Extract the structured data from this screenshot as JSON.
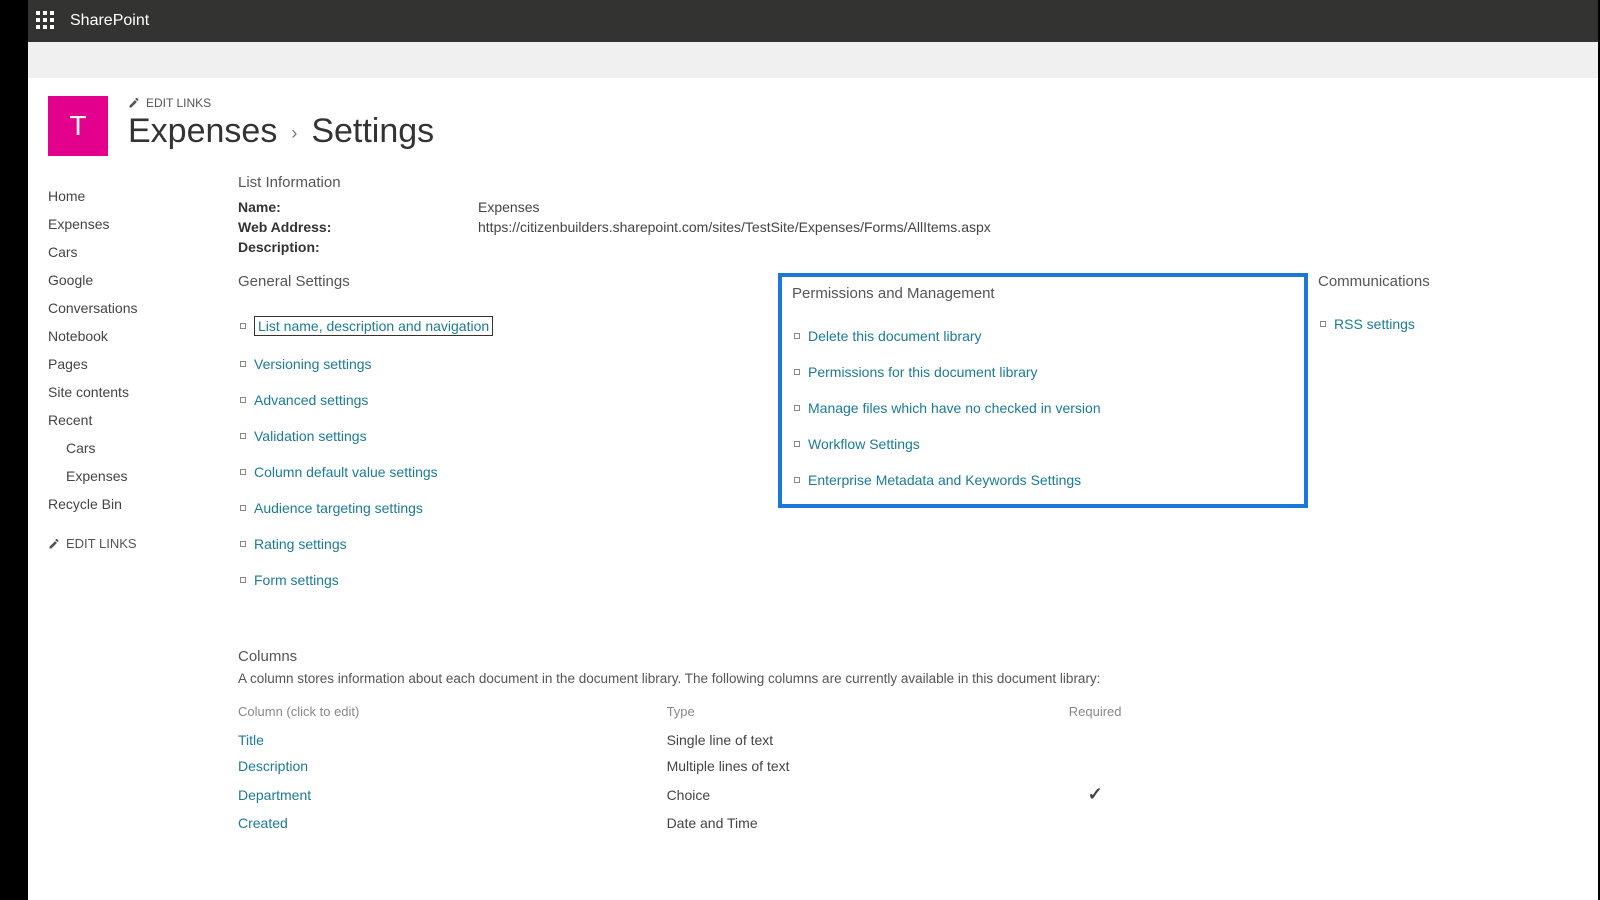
{
  "suite": {
    "product": "SharePoint"
  },
  "site": {
    "logo_letter": "T"
  },
  "editLinksLabel": "EDIT LINKS",
  "breadcrumb": {
    "parent": "Expenses",
    "current": "Settings"
  },
  "leftNav": {
    "items": [
      {
        "label": "Home"
      },
      {
        "label": "Expenses"
      },
      {
        "label": "Cars"
      },
      {
        "label": "Google"
      },
      {
        "label": "Conversations"
      },
      {
        "label": "Notebook"
      },
      {
        "label": "Pages"
      },
      {
        "label": "Site contents"
      }
    ],
    "recentLabel": "Recent",
    "recent": [
      {
        "label": "Cars"
      },
      {
        "label": "Expenses"
      }
    ],
    "recycle": "Recycle Bin"
  },
  "listInfo": {
    "heading": "List Information",
    "nameLabel": "Name:",
    "nameValue": "Expenses",
    "addrLabel": "Web Address:",
    "addrValue": "https://citizenbuilders.sharepoint.com/sites/TestSite/Expenses/Forms/AllItems.aspx",
    "descLabel": "Description:",
    "descValue": ""
  },
  "settings": {
    "general": {
      "heading": "General Settings",
      "links": [
        "List name, description and navigation",
        "Versioning settings",
        "Advanced settings",
        "Validation settings",
        "Column default value settings",
        "Audience targeting settings",
        "Rating settings",
        "Form settings"
      ]
    },
    "perms": {
      "heading": "Permissions and Management",
      "links": [
        "Delete this document library",
        "Permissions for this document library",
        "Manage files which have no checked in version",
        "Workflow Settings",
        "Enterprise Metadata and Keywords Settings"
      ]
    },
    "comm": {
      "heading": "Communications",
      "links": [
        "RSS settings"
      ]
    }
  },
  "columns": {
    "heading": "Columns",
    "desc": "A column stores information about each document in the document library. The following columns are currently available in this document library:",
    "header": {
      "name": "Column (click to edit)",
      "type": "Type",
      "required": "Required"
    },
    "rows": [
      {
        "name": "Title",
        "type": "Single line of text",
        "required": false
      },
      {
        "name": "Description",
        "type": "Multiple lines of text",
        "required": false
      },
      {
        "name": "Department",
        "type": "Choice",
        "required": true
      },
      {
        "name": "Created",
        "type": "Date and Time",
        "required": false
      }
    ]
  }
}
